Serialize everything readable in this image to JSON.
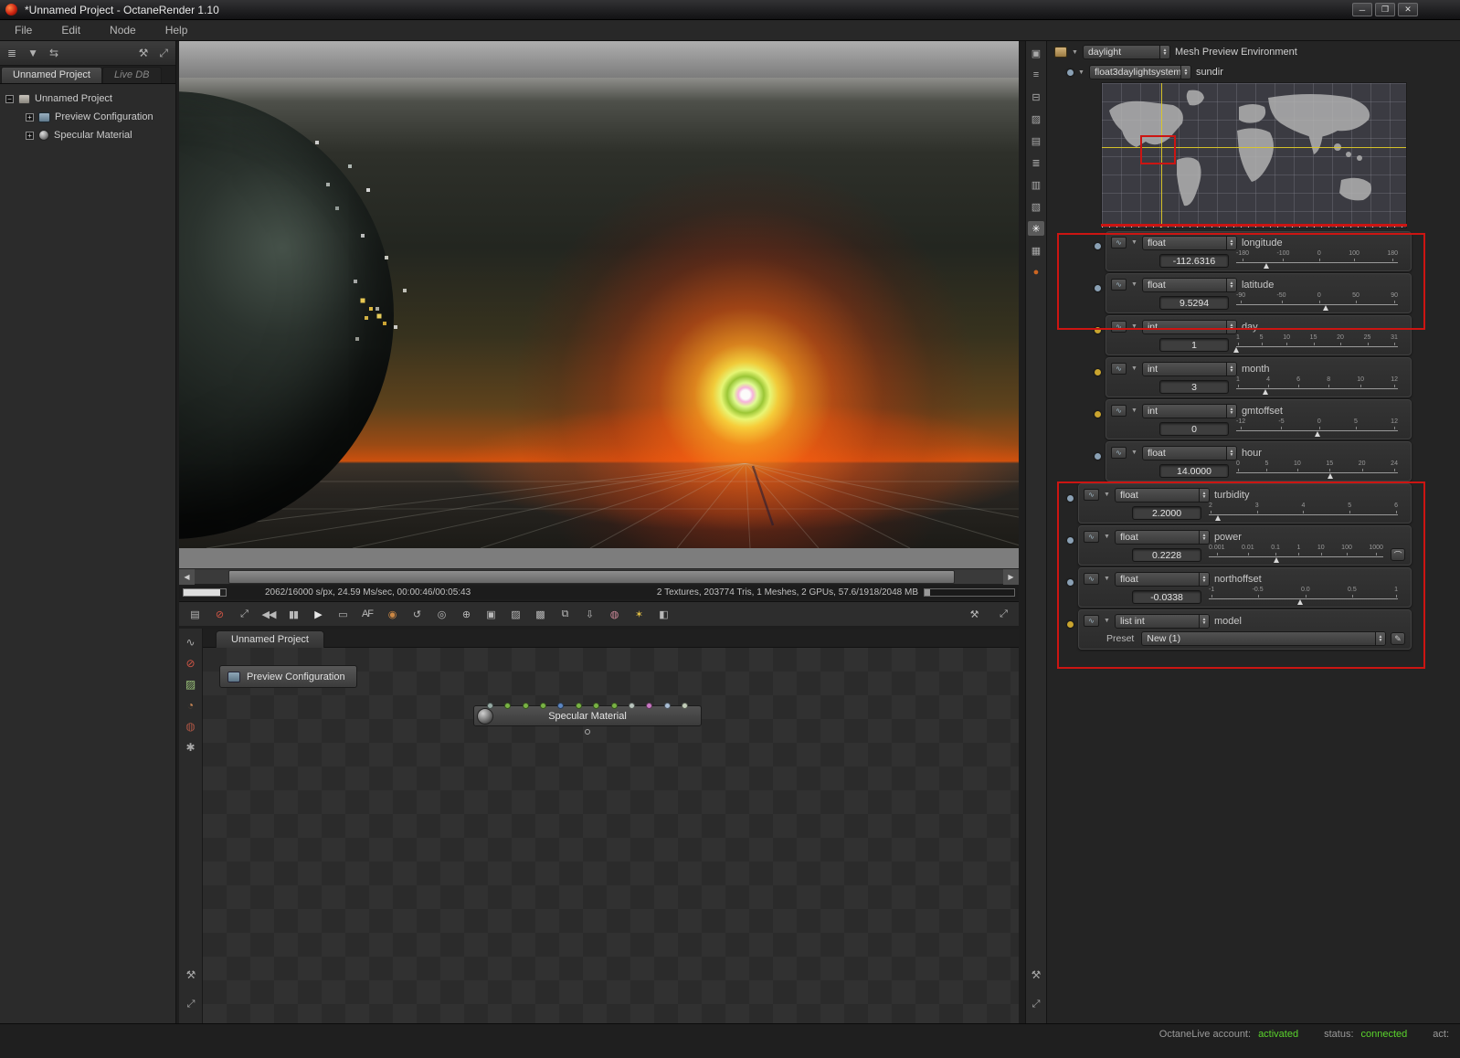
{
  "window": {
    "title": "*Unnamed Project - OctaneRender 1.10",
    "controls": [
      {
        "name": "minimize",
        "glyph": "─"
      },
      {
        "name": "maximize",
        "glyph": "❐"
      },
      {
        "name": "close",
        "glyph": "✕"
      }
    ]
  },
  "menu": {
    "items": [
      "File",
      "Edit",
      "Node",
      "Help"
    ]
  },
  "project_panel": {
    "toolbar_icons": [
      {
        "name": "node-list-icon",
        "glyph": "≣"
      },
      {
        "name": "save-project-icon",
        "glyph": "▼"
      },
      {
        "name": "import-export-icon",
        "glyph": "⇆"
      }
    ],
    "toolbar_right_icons": [
      {
        "name": "settings-wrench-icon",
        "glyph": "⚒"
      },
      {
        "name": "expand-panel-icon",
        "glyph": "⤢"
      }
    ],
    "tabs": [
      {
        "label": "Unnamed Project",
        "active": true
      },
      {
        "label": "Live DB",
        "active": false
      }
    ],
    "root": "Unnamed Project",
    "children": [
      {
        "label": "Preview Configuration",
        "icon": "node"
      },
      {
        "label": "Specular Material",
        "icon": "sphere"
      }
    ]
  },
  "viewport": {
    "progress_text": "2062/16000 s/px, 24.59 Ms/sec, 00:00:46/00:05:43",
    "stats_text": "2 Textures, 203774 Tris, 1 Meshes, 2 GPUs, 57.6/1918/2048 MB"
  },
  "render_toolbar": {
    "icons": [
      {
        "name": "save-render-icon",
        "glyph": "▤"
      },
      {
        "name": "stop-render-icon",
        "glyph": "⊘",
        "color": "#d05545"
      },
      {
        "name": "fit-viewport-icon",
        "glyph": "⤢"
      },
      {
        "name": "restart-render-icon",
        "glyph": "◀◀"
      },
      {
        "name": "pause-render-icon",
        "glyph": "▮▮"
      },
      {
        "name": "start-render-icon",
        "glyph": "▶",
        "color": "#e8e8e8"
      },
      {
        "name": "display-mode-icon",
        "glyph": "▭"
      },
      {
        "name": "autofocus-icon",
        "glyph": "AF"
      },
      {
        "name": "color-picker-icon",
        "glyph": "◉",
        "color": "#cc8844"
      },
      {
        "name": "reset-camera-icon",
        "glyph": "↺"
      },
      {
        "name": "focus-picker-icon",
        "glyph": "◎"
      },
      {
        "name": "camera-target-icon",
        "glyph": "⊕"
      },
      {
        "name": "render-region-icon",
        "glyph": "▣"
      },
      {
        "name": "alpha-mode-icon",
        "glyph": "▨"
      },
      {
        "name": "checker-background-icon",
        "glyph": "▩"
      },
      {
        "name": "copy-image-icon",
        "glyph": "⧉"
      },
      {
        "name": "export-image-icon",
        "glyph": "⇩"
      },
      {
        "name": "render-network-icon",
        "glyph": "◍",
        "color": "#cc8899"
      },
      {
        "name": "sun-study-icon",
        "glyph": "✶",
        "color": "#ddbb44"
      },
      {
        "name": "lock-view-icon",
        "glyph": "◧"
      }
    ],
    "right_icons": [
      {
        "name": "render-settings-wrench-icon",
        "glyph": "⚒"
      },
      {
        "name": "fullscreen-icon",
        "glyph": "⤢"
      }
    ]
  },
  "node_graph": {
    "tab": "Unnamed Project",
    "preview_config": "Preview Configuration",
    "material_node": "Specular Material",
    "pin_colors": [
      "#96aaa4",
      "#79b345",
      "#79b345",
      "#79b345",
      "#5c86c2",
      "#79b345",
      "#79b345",
      "#79b345",
      "#b9c4bd",
      "#c978c3",
      "#a9bdd3",
      "#c2cdb9"
    ],
    "strip_icons": [
      {
        "name": "link-tool-icon",
        "glyph": "∿"
      },
      {
        "name": "delete-node-icon",
        "glyph": "⊘",
        "color": "#d05545"
      },
      {
        "name": "image-node-icon",
        "glyph": "▨",
        "color": "#9ac07a"
      },
      {
        "name": "material-palette-icon",
        "glyph": "◔",
        "color": "#cc8855"
      },
      {
        "name": "torus-preview-icon",
        "glyph": "◍",
        "color": "#aa5544"
      },
      {
        "name": "node-gear-icon",
        "glyph": "✱"
      }
    ]
  },
  "right_strip": {
    "icons": [
      {
        "name": "camera-icon",
        "glyph": "▣"
      },
      {
        "name": "mesh-icon",
        "glyph": "≡"
      },
      {
        "name": "align-icon",
        "glyph": "⊟"
      },
      {
        "name": "texture-image-icon",
        "glyph": "▨"
      },
      {
        "name": "film-settings-icon",
        "glyph": "▤"
      },
      {
        "name": "kernel-icon",
        "glyph": "≣"
      },
      {
        "name": "database-icon",
        "glyph": "▥"
      },
      {
        "name": "imager-icon",
        "glyph": "▧"
      },
      {
        "name": "environment-star-icon",
        "glyph": "✳",
        "active": true
      },
      {
        "name": "visible-environment-icon",
        "glyph": "▦"
      },
      {
        "name": "liquid-drop-icon",
        "glyph": "●",
        "color": "#cc6622"
      }
    ]
  },
  "inspector": {
    "env": {
      "type": "daylight",
      "label": "Mesh Preview Environment"
    },
    "sundir": {
      "type": "float3daylightsystem",
      "label": "sundir"
    },
    "map": {
      "crosshair_x_pct": 19.4,
      "crosshair_y_pct": 44
    },
    "params": [
      {
        "kind": "slider",
        "type": "float",
        "name": "longitude",
        "value": "-112.6316",
        "ticks": [
          "-180",
          "-100",
          "0",
          "100",
          "180"
        ],
        "dot": "blue",
        "pos": 18.7,
        "indent": true
      },
      {
        "kind": "slider",
        "type": "float",
        "name": "latitude",
        "value": "9.5294",
        "ticks": [
          "-90",
          "-50",
          "0",
          "50",
          "90"
        ],
        "dot": "blue",
        "pos": 55.3,
        "indent": true
      },
      {
        "kind": "slider",
        "type": "int",
        "name": "day",
        "value": "1",
        "ticks": [
          "1",
          "5",
          "10",
          "15",
          "20",
          "25",
          "31"
        ],
        "dot": "yellow",
        "pos": 0,
        "indent": true
      },
      {
        "kind": "slider",
        "type": "int",
        "name": "month",
        "value": "3",
        "ticks": [
          "1",
          "4",
          "6",
          "8",
          "10",
          "12"
        ],
        "dot": "yellow",
        "pos": 18,
        "indent": true
      },
      {
        "kind": "slider",
        "type": "int",
        "name": "gmtoffset",
        "value": "0",
        "ticks": [
          "-12",
          "-5",
          "0",
          "5",
          "12"
        ],
        "dot": "yellow",
        "pos": 50,
        "indent": true
      },
      {
        "kind": "slider",
        "type": "float",
        "name": "hour",
        "value": "14.0000",
        "ticks": [
          "0",
          "5",
          "10",
          "15",
          "20",
          "24"
        ],
        "dot": "blue",
        "pos": 58.3,
        "indent": true
      },
      {
        "kind": "slider",
        "type": "float",
        "name": "turbidity",
        "value": "2.2000",
        "ticks": [
          "2",
          "3",
          "4",
          "5",
          "6"
        ],
        "dot": "blue",
        "pos": 5,
        "indent": false
      },
      {
        "kind": "slider",
        "type": "float",
        "name": "power",
        "value": "0.2228",
        "ticks": [
          "0.001",
          "0.01",
          "0.1",
          "1",
          "10",
          "100",
          "1000"
        ],
        "dot": "blue",
        "pos": 39,
        "indent": false,
        "curve": true
      },
      {
        "kind": "slider",
        "type": "float",
        "name": "northoffset",
        "value": "-0.0338",
        "ticks": [
          "-1",
          "-0.5",
          "0.0",
          "0.5",
          "1"
        ],
        "dot": "blue",
        "pos": 48.3,
        "indent": false
      },
      {
        "kind": "list",
        "type": "list int",
        "name": "model",
        "dot": "yellow",
        "indent": false,
        "preset_label": "Preset",
        "preset_value": "New (1)"
      }
    ]
  },
  "status_bar": {
    "account_label": "OctaneLive account:",
    "account_value": "activated",
    "status_label": "status:",
    "status_value": "connected",
    "act_label": "act:",
    "green": "#5ad42c",
    "annotation_red": "#cc1512"
  }
}
